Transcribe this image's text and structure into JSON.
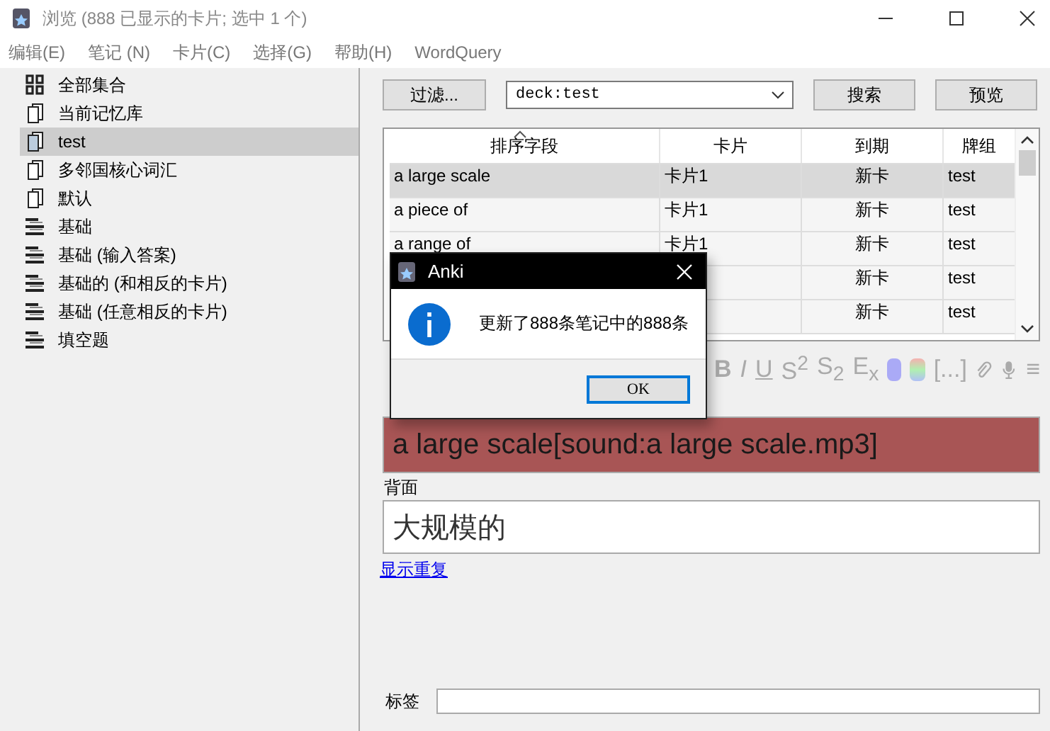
{
  "window": {
    "title": "浏览 (888 已显示的卡片; 选中 1 个)"
  },
  "menu": [
    "编辑(E)",
    "笔记 (N)",
    "卡片(C)",
    "选择(G)",
    "帮助(H)",
    "WordQuery"
  ],
  "sidebar": {
    "items": [
      {
        "label": "全部集合",
        "kind": "collection",
        "selected": false
      },
      {
        "label": "当前记忆库",
        "kind": "deck",
        "selected": false
      },
      {
        "label": "test",
        "kind": "deck",
        "selected": true
      },
      {
        "label": "多邻国核心词汇",
        "kind": "deck",
        "selected": false
      },
      {
        "label": "默认",
        "kind": "deck",
        "selected": false
      },
      {
        "label": "基础",
        "kind": "notetype",
        "selected": false
      },
      {
        "label": "基础 (输入答案)",
        "kind": "notetype",
        "selected": false
      },
      {
        "label": "基础的 (和相反的卡片)",
        "kind": "notetype",
        "selected": false
      },
      {
        "label": "基础 (任意相反的卡片)",
        "kind": "notetype",
        "selected": false
      },
      {
        "label": "填空题",
        "kind": "notetype",
        "selected": false
      }
    ]
  },
  "search": {
    "filter_button": "过滤...",
    "query": "deck:test",
    "search_button": "搜索",
    "preview_button": "预览"
  },
  "table": {
    "columns": [
      "排序字段",
      "卡片",
      "到期",
      "牌组"
    ],
    "rows": [
      {
        "cells": [
          "a large scale",
          "卡片1",
          "新卡",
          "test"
        ],
        "selected": true
      },
      {
        "cells": [
          "a piece of",
          "卡片1",
          "新卡",
          "test"
        ],
        "selected": false
      },
      {
        "cells": [
          "a range of",
          "卡片1",
          "新卡",
          "test"
        ],
        "selected": false
      },
      {
        "cells": [
          "",
          "",
          "新卡",
          "test"
        ],
        "selected": false
      },
      {
        "cells": [
          "",
          "",
          "新卡",
          "test"
        ],
        "selected": false
      }
    ]
  },
  "editor": {
    "toolbar": [
      "B",
      "I",
      "U",
      "S$^{2}$",
      "S$_{2}$",
      "E$_{x}$",
      "[...]",
      "≡"
    ],
    "front_value": "a large scale[sound:a large scale.mp3]",
    "back_label": "背面",
    "back_value": "大规模的",
    "link": "显示重复",
    "tags_label": "标签"
  },
  "dialog": {
    "title": "Anki",
    "message": "更新了888条笔记中的888条",
    "ok_button": "OK"
  }
}
